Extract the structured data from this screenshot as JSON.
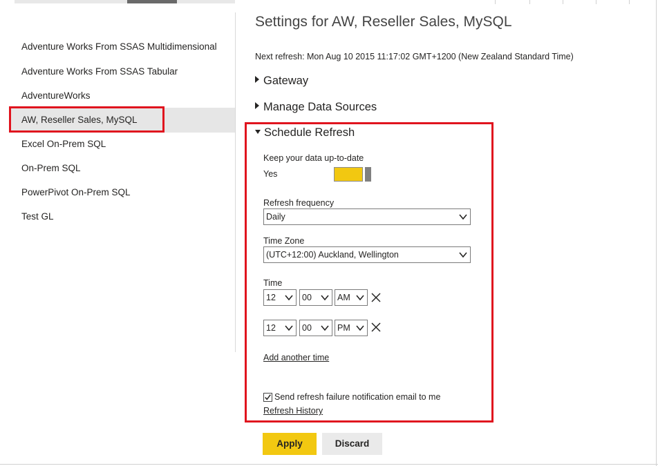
{
  "sidebar": {
    "items": [
      {
        "label": "Adventure Works From SSAS Multidimensional",
        "selected": false
      },
      {
        "label": "Adventure Works From SSAS Tabular",
        "selected": false
      },
      {
        "label": "AdventureWorks",
        "selected": false
      },
      {
        "label": "AW, Reseller Sales, MySQL",
        "selected": true
      },
      {
        "label": "Excel On-Prem SQL",
        "selected": false
      },
      {
        "label": "On-Prem SQL",
        "selected": false
      },
      {
        "label": "PowerPivot On-Prem SQL",
        "selected": false
      },
      {
        "label": "Test GL",
        "selected": false
      }
    ]
  },
  "main": {
    "title": "Settings for AW, Reseller Sales, MySQL",
    "next_refresh": "Next refresh: Mon Aug 10 2015 11:17:02 GMT+1200 (New Zealand Standard Time)",
    "sections": {
      "gateway": "Gateway",
      "manage": "Manage Data Sources",
      "schedule": "Schedule Refresh"
    },
    "schedule": {
      "keep_label": "Keep your data up-to-date",
      "keep_value": "Yes",
      "keep_on": true,
      "frequency_label": "Refresh frequency",
      "frequency_value": "Daily",
      "timezone_label": "Time Zone",
      "timezone_value": "(UTC+12:00) Auckland, Wellington",
      "time_label": "Time",
      "times": [
        {
          "hour": "12",
          "minute": "00",
          "ampm": "AM"
        },
        {
          "hour": "12",
          "minute": "00",
          "ampm": "PM"
        }
      ],
      "add_time": "Add another time",
      "notify_label": "Send refresh failure notification email to me",
      "notify_checked": true,
      "history_link": "Refresh History"
    },
    "buttons": {
      "apply": "Apply",
      "discard": "Discard"
    }
  },
  "colors": {
    "accent": "#f2c811",
    "highlight": "#e0141e",
    "selected_bg": "#e6e6e6"
  }
}
